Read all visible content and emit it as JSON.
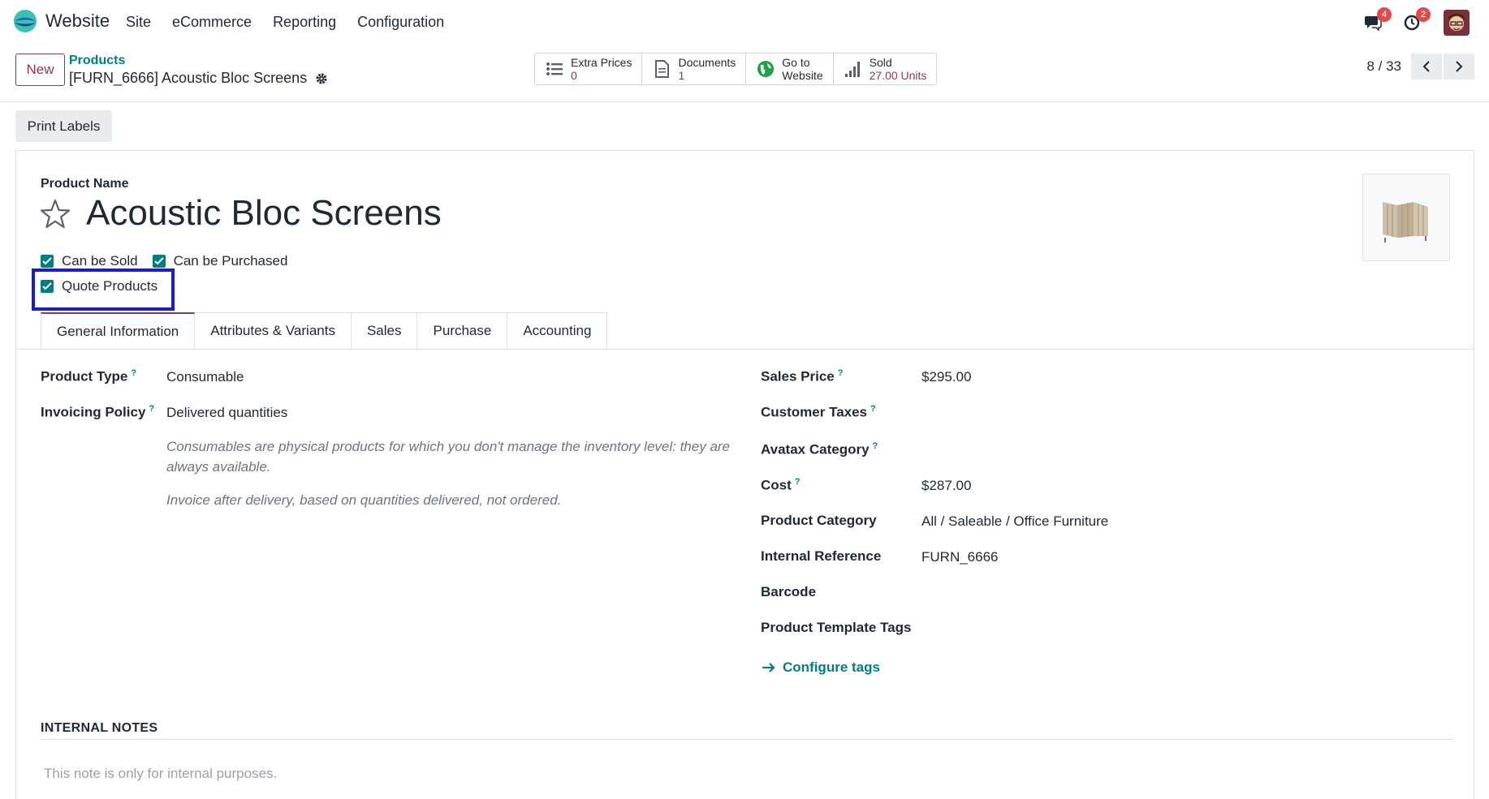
{
  "app": {
    "name": "Website"
  },
  "menu": [
    "Site",
    "eCommerce",
    "Reporting",
    "Configuration"
  ],
  "systray": {
    "messages_count": "4",
    "activity_count": "2"
  },
  "control": {
    "new_label": "New",
    "breadcrumb_parent": "Products",
    "breadcrumb_current": "[FURN_6666] Acoustic Bloc Screens",
    "pager": "8 / 33"
  },
  "smart_buttons": [
    {
      "label": "Extra Prices",
      "value": "0",
      "icon": "list-icon"
    },
    {
      "label": "Documents",
      "value": "1",
      "icon": "document-icon"
    },
    {
      "label": "Go to",
      "value": "Website",
      "icon": "globe-icon"
    },
    {
      "label": "Sold",
      "value": "27.00 Units",
      "icon": "bar-chart-icon"
    }
  ],
  "actions": {
    "print_labels": "Print Labels"
  },
  "form": {
    "product_name_label": "Product Name",
    "product_name": "Acoustic Bloc Screens",
    "checkboxes": {
      "can_be_sold": "Can be Sold",
      "can_be_purchased": "Can be Purchased",
      "quote_products": "Quote Products"
    },
    "tabs": [
      "General Information",
      "Attributes & Variants",
      "Sales",
      "Purchase",
      "Accounting"
    ],
    "left_fields": {
      "product_type_label": "Product Type",
      "product_type_value": "Consumable",
      "invoicing_policy_label": "Invoicing Policy",
      "invoicing_policy_value": "Delivered quantities",
      "help_consumables": "Consumables are physical products for which you don't manage the inventory level: they are always available.",
      "help_invoice": "Invoice after delivery, based on quantities delivered, not ordered."
    },
    "right_fields": {
      "sales_price_label": "Sales Price",
      "sales_price_value": "$295.00",
      "customer_taxes_label": "Customer Taxes",
      "avatax_label": "Avatax Category",
      "cost_label": "Cost",
      "cost_value": "$287.00",
      "category_label": "Product Category",
      "category_value": "All / Saleable / Office Furniture",
      "internal_ref_label": "Internal Reference",
      "internal_ref_value": "FURN_6666",
      "barcode_label": "Barcode",
      "template_tags_label": "Product Template Tags",
      "configure_tags": "Configure tags"
    },
    "notes": {
      "title": "INTERNAL NOTES",
      "placeholder": "This note is only for internal purposes."
    }
  },
  "colors": {
    "accent": "#017e84",
    "brand": "#8a3b4d",
    "highlight": "#1a1ad8"
  }
}
